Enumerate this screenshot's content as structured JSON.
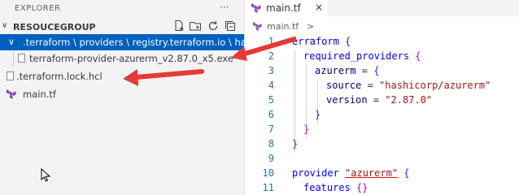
{
  "explorer": {
    "title": "EXPLORER",
    "more": "···",
    "folder": "RESOUCEGROUP",
    "items": [
      {
        "label": ".terraform \\ providers \\ registry.terraform.io \\ hashi..."
      },
      {
        "label": "terraform-provider-azurerm_v2.87.0_x5.exe"
      },
      {
        "label": ".terraform.lock.hcl"
      },
      {
        "label": "main.tf"
      }
    ]
  },
  "tab": {
    "label": "main.tf",
    "close": "×"
  },
  "breadcrumb": {
    "file": "main.tf",
    "sep": "> ..."
  },
  "lines": [
    "1",
    "2",
    "3",
    "4",
    "5",
    "6",
    "7",
    "8",
    "9",
    "10",
    "11"
  ],
  "code": {
    "l1a": "erraform",
    "l1b": " {",
    "l2a": "required_providers",
    "l2b": " {",
    "l3a": "azurerm",
    "l3b": " = ",
    "l3c": "{",
    "l4a": "source",
    "l4b": " = ",
    "l4c": "\"hashicorp/azurerm\"",
    "l5a": "version",
    "l5b": " = ",
    "l5c": "\"2.87.0\"",
    "l6": "}",
    "l7": "}",
    "l8": "}",
    "l9": "",
    "l10a": "provider",
    "l10b": " ",
    "l10c": "\"azurerm\"",
    "l10d": " {",
    "l11a": "features",
    "l11b": " {}"
  },
  "colors": {
    "selection": "#0060c0",
    "arrow": "#e53935"
  }
}
